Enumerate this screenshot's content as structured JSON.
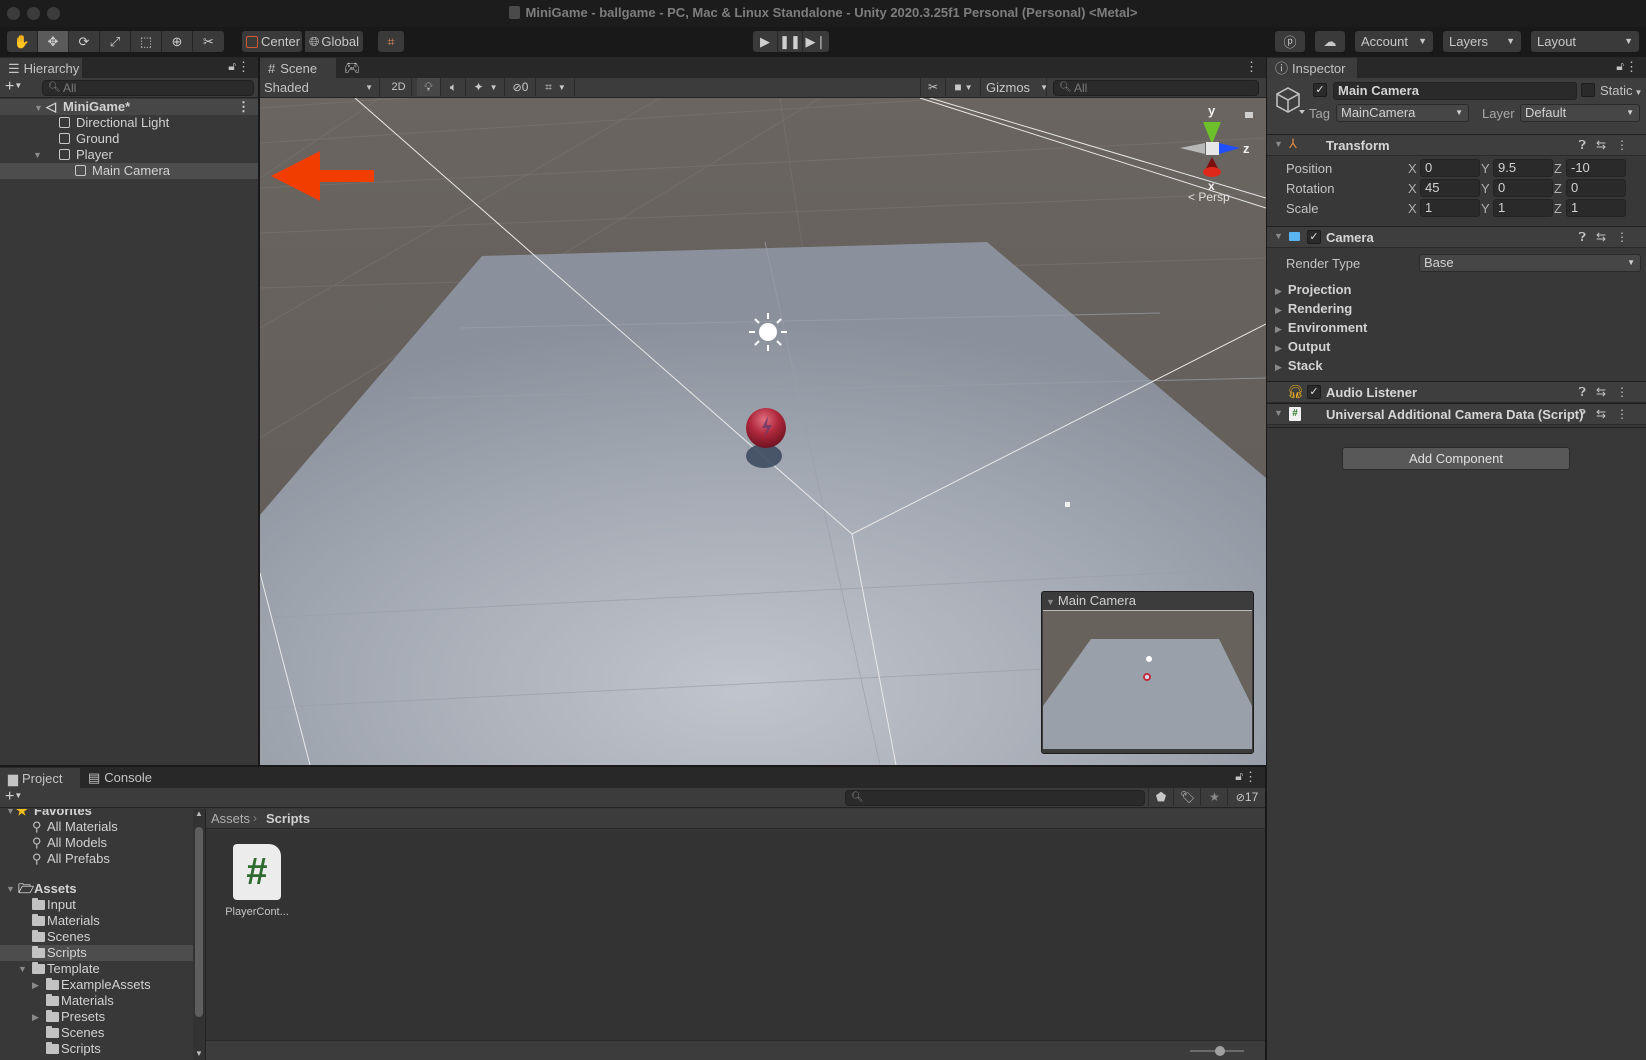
{
  "window": {
    "title": "MiniGame - ballgame - PC, Mac & Linux Standalone - Unity 2020.3.25f1 Personal (Personal) <Metal>"
  },
  "toolbar": {
    "tools": [
      "hand-tool",
      "move-tool",
      "rotate-tool",
      "scale-tool",
      "rect-tool",
      "transform-tool",
      "custom-tool"
    ],
    "active_tool": "move-tool",
    "pivot_label": "Center",
    "space_label": "Global",
    "account_label": "Account",
    "layers_label": "Layers",
    "layout_label": "Layout"
  },
  "hierarchy": {
    "tab_label": "Hierarchy",
    "search_placeholder": "All",
    "scene_name": "MiniGame*",
    "items": [
      {
        "label": "Directional Light",
        "depth": 1,
        "expanded": null,
        "selected": false
      },
      {
        "label": "Ground",
        "depth": 1,
        "expanded": null,
        "selected": false
      },
      {
        "label": "Player",
        "depth": 1,
        "expanded": true,
        "selected": false
      },
      {
        "label": "Main Camera",
        "depth": 2,
        "expanded": null,
        "selected": true
      }
    ]
  },
  "scene": {
    "tabs": [
      {
        "label": "Scene",
        "active": true
      },
      {
        "label": "Game",
        "active": false
      }
    ],
    "draw_mode": "Shaded",
    "mode_2d_label": "2D",
    "hidden_count": "0",
    "gizmos_label": "Gizmos",
    "search_placeholder": "All",
    "projection_label": "< Persp",
    "gizmo_axes": {
      "x": "x",
      "y": "y",
      "z": "z"
    },
    "camera_preview_title": "Main Camera",
    "annotation_arrow_color": "#f23d00"
  },
  "inspector": {
    "tab_label": "Inspector",
    "object": {
      "active": true,
      "name": "Main Camera",
      "static_label": "Static",
      "tag_label": "Tag",
      "tag_value": "MainCamera",
      "layer_label": "Layer",
      "layer_value": "Default"
    },
    "transform": {
      "title": "Transform",
      "rows": [
        {
          "label": "Position",
          "x": "0",
          "y": "9.5",
          "z": "-10"
        },
        {
          "label": "Rotation",
          "x": "45",
          "y": "0",
          "z": "0"
        },
        {
          "label": "Scale",
          "x": "1",
          "y": "1",
          "z": "1"
        }
      ]
    },
    "camera": {
      "title": "Camera",
      "enabled": true,
      "render_type_label": "Render Type",
      "render_type_value": "Base",
      "foldouts": [
        "Projection",
        "Rendering",
        "Environment",
        "Output",
        "Stack"
      ]
    },
    "audio_listener": {
      "title": "Audio Listener",
      "enabled": true
    },
    "script_component": {
      "title": "Universal Additional Camera Data (Script)"
    },
    "add_component_label": "Add Component"
  },
  "project": {
    "tabs": [
      {
        "label": "Project",
        "active": true
      },
      {
        "label": "Console",
        "active": false
      }
    ],
    "hidden_packages_count": "17",
    "favorites_label": "Favorites",
    "favorites": [
      "All Materials",
      "All Models",
      "All Prefabs"
    ],
    "assets_label": "Assets",
    "tree": [
      {
        "label": "Input",
        "depth": 1,
        "expandable": false,
        "selected": false
      },
      {
        "label": "Materials",
        "depth": 1,
        "expandable": false,
        "selected": false
      },
      {
        "label": "Scenes",
        "depth": 1,
        "expandable": false,
        "selected": false
      },
      {
        "label": "Scripts",
        "depth": 1,
        "expandable": false,
        "selected": true
      },
      {
        "label": "Template",
        "depth": 1,
        "expandable": true,
        "expanded": true,
        "selected": false
      },
      {
        "label": "ExampleAssets",
        "depth": 2,
        "expandable": true,
        "expanded": false,
        "selected": false
      },
      {
        "label": "Materials",
        "depth": 2,
        "expandable": false,
        "selected": false
      },
      {
        "label": "Presets",
        "depth": 2,
        "expandable": true,
        "expanded": false,
        "selected": false
      },
      {
        "label": "Scenes",
        "depth": 2,
        "expandable": false,
        "selected": false
      },
      {
        "label": "Scripts",
        "depth": 2,
        "expandable": false,
        "selected": false
      }
    ],
    "breadcrumb": [
      "Assets",
      "Scripts"
    ],
    "files": [
      {
        "label": "PlayerCont...",
        "type": "csharp-script"
      }
    ],
    "icon_size_slider": 0.55
  }
}
